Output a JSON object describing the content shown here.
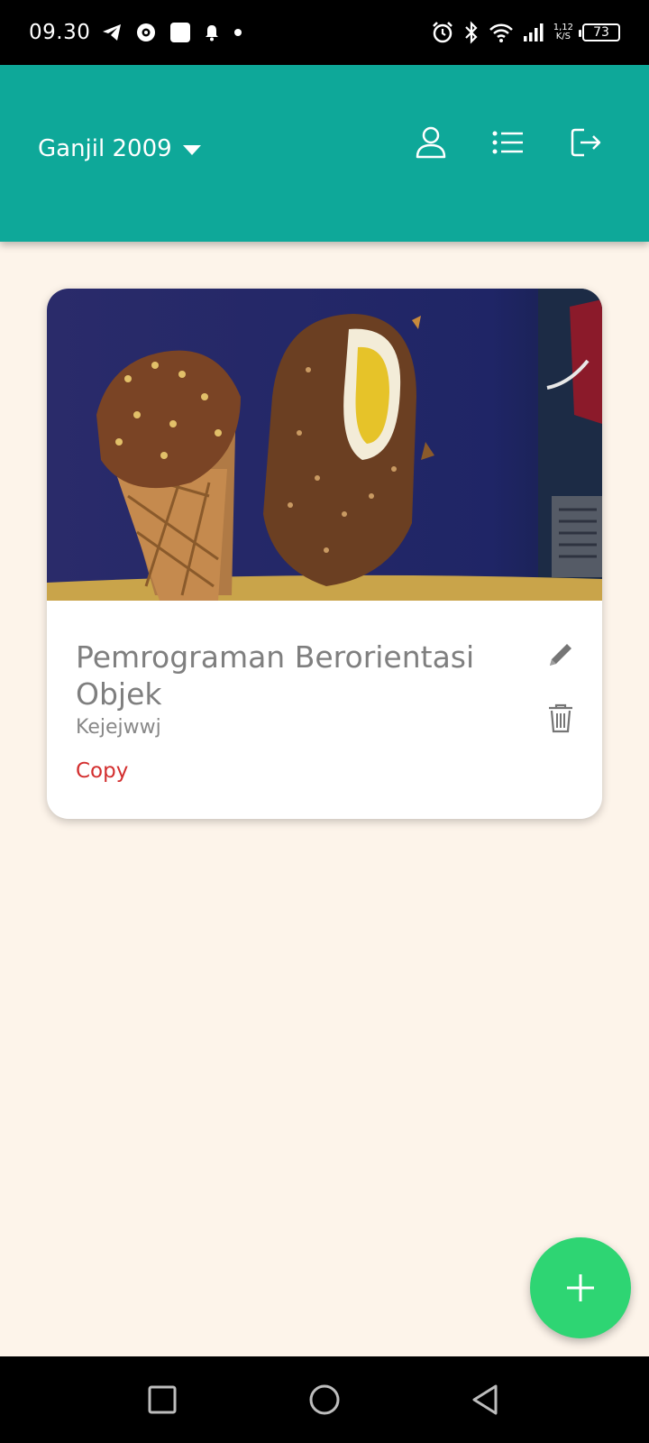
{
  "status_bar": {
    "time": "09.30",
    "left_icons": [
      "telegram-icon",
      "circle-app-icon",
      "square-app-icon",
      "bell-icon",
      "dot-icon"
    ],
    "right_icons": [
      "alarm-icon",
      "bluetooth-icon",
      "wifi-icon",
      "signal-icon"
    ],
    "speed_value": "1,12",
    "speed_unit": "K/S",
    "battery": "73"
  },
  "app_bar": {
    "semester": "Ganjil 2009",
    "actions": [
      "profile-icon",
      "list-icon",
      "logout-icon"
    ],
    "color": "#0ea899"
  },
  "course_card": {
    "image": "ice-cream-photo",
    "title": "Pemrograman Berorientasi Objek",
    "subtitle": "Kejejwwj",
    "copy_label": "Copy",
    "actions": [
      "edit-icon",
      "delete-icon"
    ]
  },
  "fab": {
    "icon": "plus-icon",
    "color": "#2ed573"
  },
  "nav_bar": {
    "buttons": [
      "recents-icon",
      "home-icon",
      "back-icon"
    ]
  }
}
